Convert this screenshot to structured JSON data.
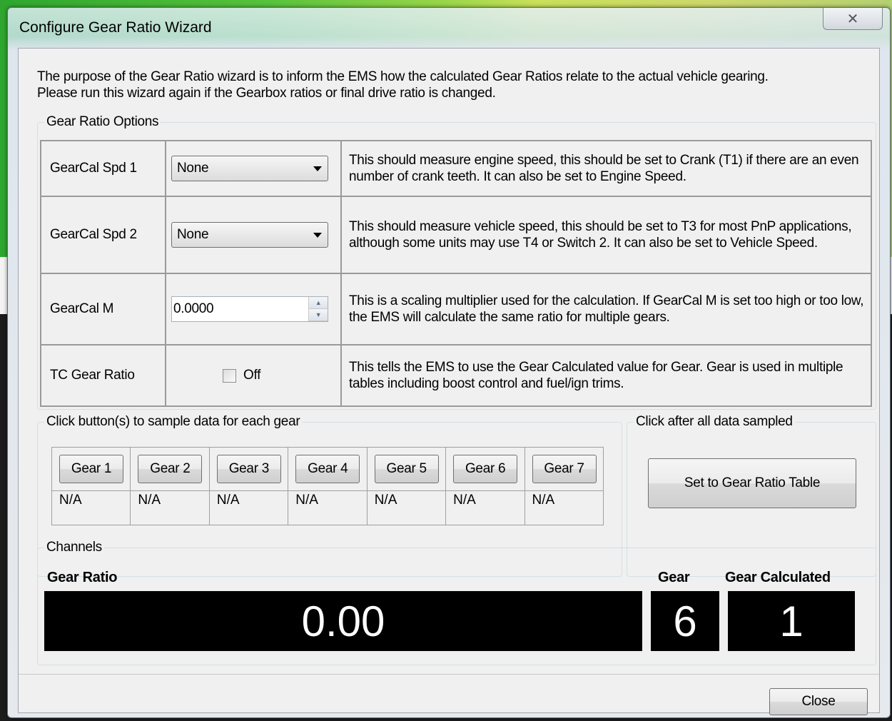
{
  "window": {
    "title": "Configure Gear Ratio Wizard",
    "close_glyph": "✕"
  },
  "intro": {
    "line1": "The purpose of the Gear Ratio wizard is to inform the EMS how the calculated Gear Ratios relate to the actual vehicle gearing.",
    "line2": "Please run this wizard again if the Gearbox ratios or final drive ratio is changed."
  },
  "options": {
    "legend": "Gear Ratio Options",
    "rows": [
      {
        "label": "GearCal Spd 1",
        "value": "None",
        "desc": "This should measure engine speed, this should be set to Crank (T1) if there are an even number of crank teeth. It can also be set to Engine Speed."
      },
      {
        "label": "GearCal Spd 2",
        "value": "None",
        "desc": "This should measure vehicle speed, this should be set to T3 for most PnP applications, although some units may use T4 or Switch 2. It can also be set to Vehicle Speed."
      },
      {
        "label": "GearCal M",
        "value": "0.0000",
        "desc": "This is a scaling multiplier used for the calculation. If GearCal M is set too high or too low, the EMS will calculate the same ratio for multiple gears."
      },
      {
        "label": "TC Gear Ratio",
        "value": "Off",
        "desc": "This tells the EMS to use the Gear Calculated value for Gear. Gear is used in multiple tables including boost control and fuel/ign trims."
      }
    ]
  },
  "sampling": {
    "legend": "Click button(s) to sample data for each gear",
    "gears": [
      {
        "label": "Gear 1",
        "value": "N/A"
      },
      {
        "label": "Gear 2",
        "value": "N/A"
      },
      {
        "label": "Gear 3",
        "value": "N/A"
      },
      {
        "label": "Gear 4",
        "value": "N/A"
      },
      {
        "label": "Gear 5",
        "value": "N/A"
      },
      {
        "label": "Gear 6",
        "value": "N/A"
      },
      {
        "label": "Gear 7",
        "value": "N/A"
      }
    ]
  },
  "apply": {
    "legend": "Click after all data sampled",
    "button": "Set to Gear Ratio Table"
  },
  "channels": {
    "legend": "Channels",
    "gear_ratio": {
      "label": "Gear Ratio",
      "value": "0.00"
    },
    "gear": {
      "label": "Gear",
      "value": "6"
    },
    "gear_calculated": {
      "label": "Gear Calculated",
      "value": "1"
    }
  },
  "footer": {
    "close_label": "Close"
  },
  "icons": {
    "combo_arrow": "caret-down",
    "spin_up": "▲",
    "spin_down": "▼"
  }
}
